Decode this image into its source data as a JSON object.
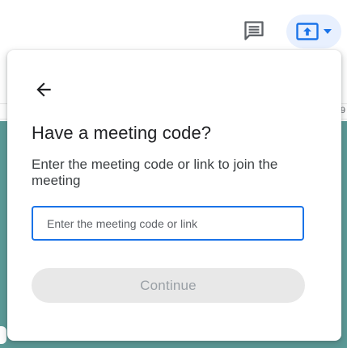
{
  "toolbar": {
    "comment_icon": "comment-icon",
    "present_icon": "present-to-all-icon",
    "present_caret_icon": "caret-down-icon",
    "accent_color": "#1a73e8",
    "present_button_bg": "#e8f0fe"
  },
  "background": {
    "ruler_number": "9",
    "teal_color": "#5b9a97"
  },
  "dialog": {
    "back_icon": "arrow-back-icon",
    "title": "Have a meeting code?",
    "description": "Enter the meeting code or link to join the meeting",
    "input": {
      "placeholder": "Enter the meeting code or link",
      "value": ""
    },
    "continue_label": "Continue",
    "continue_enabled": false
  }
}
